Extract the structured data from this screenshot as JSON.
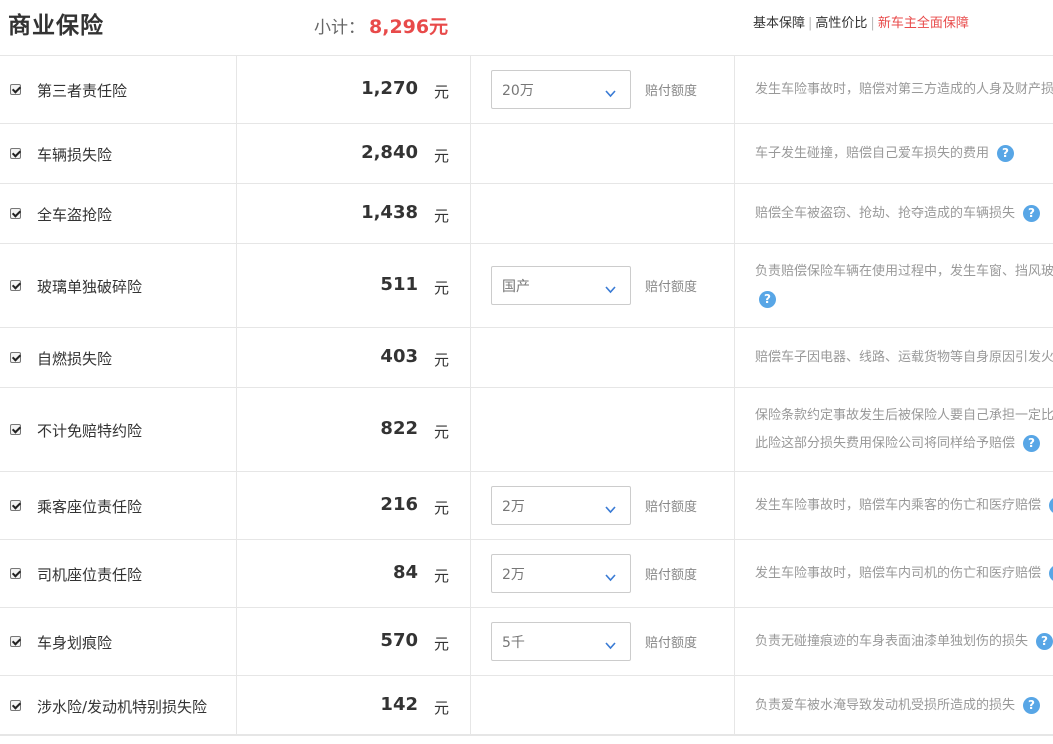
{
  "header": {
    "title": "商业保险",
    "subtotal_label": "小计：",
    "subtotal_value": "8,296元",
    "plans": [
      "基本保障",
      "高性价比",
      "新车主全面保障"
    ]
  },
  "colors": {
    "accent_red": "#e84a4a",
    "help_blue": "#58a6e6"
  },
  "rows": [
    {
      "name": "第三者责任险",
      "price": "1,270",
      "unit": "元",
      "option": "20万",
      "option_label": "赔付额度",
      "desc": [
        "发生车险事故时，赔偿对第三方造成的人身及财产损失"
      ]
    },
    {
      "name": "车辆损失险",
      "price": "2,840",
      "unit": "元",
      "option": null,
      "option_label": null,
      "desc": [
        "车子发生碰撞，赔偿自己爱车损失的费用"
      ]
    },
    {
      "name": "全车盗抢险",
      "price": "1,438",
      "unit": "元",
      "option": null,
      "option_label": null,
      "desc": [
        "赔偿全车被盗窃、抢劫、抢夺造成的车辆损失"
      ]
    },
    {
      "name": "玻璃单独破碎险",
      "price": "511",
      "unit": "元",
      "option": "国产",
      "option_label": "赔付额度",
      "desc": [
        "负责赔偿保险车辆在使用过程中，发生车窗、挡风玻璃"
      ]
    },
    {
      "name": "自燃损失险",
      "price": "403",
      "unit": "元",
      "option": null,
      "option_label": null,
      "desc": [
        "赔偿车子因电器、线路、运载货物等自身原因引发火灾"
      ]
    },
    {
      "name": "不计免赔特约险",
      "price": "822",
      "unit": "元",
      "option": null,
      "option_label": null,
      "desc": [
        "保险条款约定事故发生后被保险人要自己承担一定比例",
        "此险这部分损失费用保险公司将同样给予赔偿"
      ]
    },
    {
      "name": "乘客座位责任险",
      "price": "216",
      "unit": "元",
      "option": "2万",
      "option_label": "赔付额度",
      "desc": [
        "发生车险事故时，赔偿车内乘客的伤亡和医疗赔偿"
      ]
    },
    {
      "name": "司机座位责任险",
      "price": "84",
      "unit": "元",
      "option": "2万",
      "option_label": "赔付额度",
      "desc": [
        "发生车险事故时，赔偿车内司机的伤亡和医疗赔偿"
      ]
    },
    {
      "name": "车身划痕险",
      "price": "570",
      "unit": "元",
      "option": "5千",
      "option_label": "赔付额度",
      "desc": [
        "负责无碰撞痕迹的车身表面油漆单独划伤的损失"
      ]
    },
    {
      "name": "涉水险/发动机特别损失险",
      "price": "142",
      "unit": "元",
      "option": null,
      "option_label": null,
      "desc": [
        "负责爱车被水淹导致发动机受损所造成的损失"
      ]
    }
  ],
  "help_icon": "question-circle-icon",
  "chevron_icon": "chevron-down-icon"
}
